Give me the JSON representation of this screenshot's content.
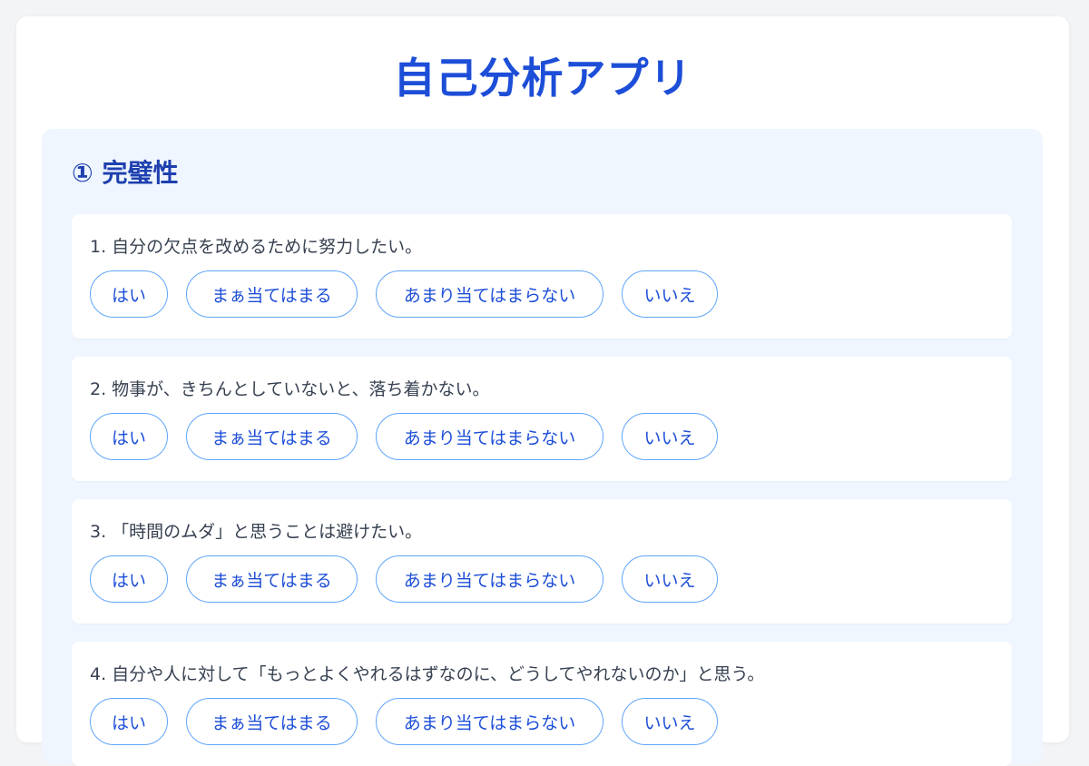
{
  "app": {
    "title": "自己分析アプリ"
  },
  "section": {
    "title": "① 完璧性",
    "questions": [
      {
        "text": "1. 自分の欠点を改めるために努力したい。"
      },
      {
        "text": "2. 物事が、きちんとしていないと、落ち着かない。"
      },
      {
        "text": "3. 「時間のムダ」と思うことは避けたい。"
      },
      {
        "text": "4. 自分や人に対して「もっとよくやれるはずなのに、どうしてやれないのか」と思う。"
      }
    ]
  },
  "options": [
    "はい",
    "まぁ当てはまる",
    "あまり当てはまらない",
    "いいえ"
  ],
  "colors": {
    "accent": "#1d4ed8",
    "section_bg": "#eff6ff",
    "option_border": "#60a5fa",
    "page_bg": "#f3f4f6"
  }
}
